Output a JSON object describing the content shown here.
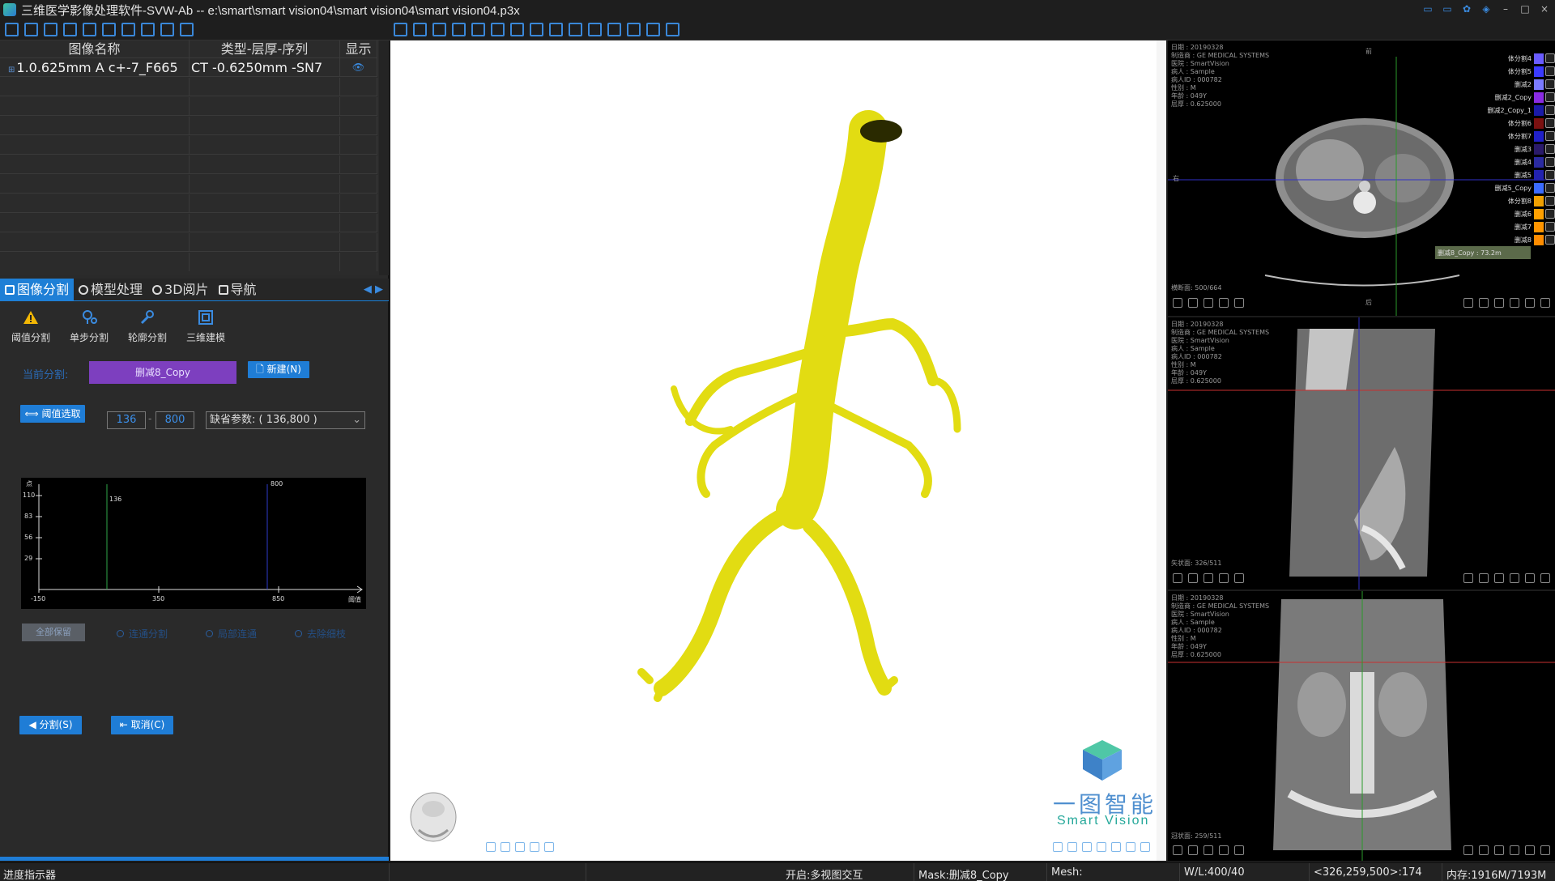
{
  "window": {
    "title": "三维医学影像处理软件-SVW-Ab -- e:\\smart\\smart vision04\\smart vision04\\smart vision04.p3x"
  },
  "image_table": {
    "headers": [
      "图像名称",
      "类型-层厚-序列",
      "显示"
    ],
    "rows": [
      {
        "name": "1.0.625mm A c+-7_F665",
        "type": "CT -0.6250mm -SN7"
      }
    ]
  },
  "tabs": [
    "图像分割",
    "模型处理",
    "3D阅片",
    "导航"
  ],
  "seg_tools": [
    "阈值分割",
    "单步分割",
    "轮廓分割",
    "三维建模"
  ],
  "segmentation": {
    "current_label": "当前分割:",
    "current_value": "删减8_Copy",
    "new_button": "新建(N)",
    "threshold_button": "阈值选取",
    "low": "136",
    "high": "800",
    "preset": "缺省参数: ( 136,800 )",
    "hist_yticks": [
      "110",
      "83",
      "56",
      "29"
    ],
    "hist_ylabel": "点",
    "hist_xticks": [
      "-150",
      "350",
      "850"
    ],
    "hist_xlabel": "阈值",
    "hist_marker_low": "136",
    "hist_marker_high": "800",
    "modes": [
      "全部保留",
      "连通分割",
      "局部连通",
      "去除细枝"
    ],
    "segment_button": "分割(S)",
    "cancel_button": "取消(C)"
  },
  "progress": {
    "label": "进度指示器",
    "value": 1.0
  },
  "status": {
    "mode": "开启:多视图交互",
    "mask": "Mask:删减8_Copy",
    "mesh": "Mesh:",
    "wl": "W/L:400/40",
    "coords": "<326,259,500>:174",
    "memory": "内存:1916M/7193M"
  },
  "brand": {
    "cn": "一图智能",
    "en": "Smart Vision"
  },
  "viewports": [
    {
      "info": [
        "日期 : 20190328",
        "制造商 : GE MEDICAL SYSTEMS",
        "医院 : SmartVision",
        "病人 : Sample",
        "病人ID : 000782",
        "性别 : M",
        "年龄 : 049Y",
        "层厚 : 0.625000"
      ],
      "footer": "横断面: 500/664"
    },
    {
      "info": [
        "日期 : 20190328",
        "制造商 : GE MEDICAL SYSTEMS",
        "医院 : SmartVision",
        "病人 : Sample",
        "病人ID : 000782",
        "性别 : M",
        "年龄 : 049Y",
        "层厚 : 0.625000"
      ],
      "footer": "矢状面: 326/511"
    },
    {
      "info": [
        "日期 : 20190328",
        "制造商 : GE MEDICAL SYSTEMS",
        "医院 : SmartVision",
        "病人 : Sample",
        "病人ID : 000782",
        "性别 : M",
        "年龄 : 049Y",
        "层厚 : 0.625000"
      ],
      "footer": "冠状面: 259/511"
    }
  ],
  "orient": {
    "top": "前",
    "left": "右",
    "bottom": "后"
  },
  "legend": [
    {
      "name": "体分割4",
      "color": "#6a5cff"
    },
    {
      "name": "体分割5",
      "color": "#3a3aff"
    },
    {
      "name": "删减2",
      "color": "#7a7aff"
    },
    {
      "name": "删减2_Copy",
      "color": "#8a2be2"
    },
    {
      "name": "删减2_Copy_1",
      "color": "#1a1aa8"
    },
    {
      "name": "体分割6",
      "color": "#7a1010"
    },
    {
      "name": "体分割7",
      "color": "#2020c8"
    },
    {
      "name": "删减3",
      "color": "#2a1a6a"
    },
    {
      "name": "删减4",
      "color": "#2a2aa0"
    },
    {
      "name": "删减5",
      "color": "#2222b0"
    },
    {
      "name": "删减5_Copy",
      "color": "#3b6bff"
    },
    {
      "name": "体分割8",
      "color": "#f0a000"
    },
    {
      "name": "删减6",
      "color": "#ffa000"
    },
    {
      "name": "删减7",
      "color": "#ff9500"
    },
    {
      "name": "删减8",
      "color": "#ff8c00"
    }
  ],
  "legend_selected": "删减8_Copy : 73.2m",
  "colors": {
    "accent": "#1f7dd6",
    "model": "#e6e21a",
    "seg_value_bg": "#7d3fbf"
  }
}
